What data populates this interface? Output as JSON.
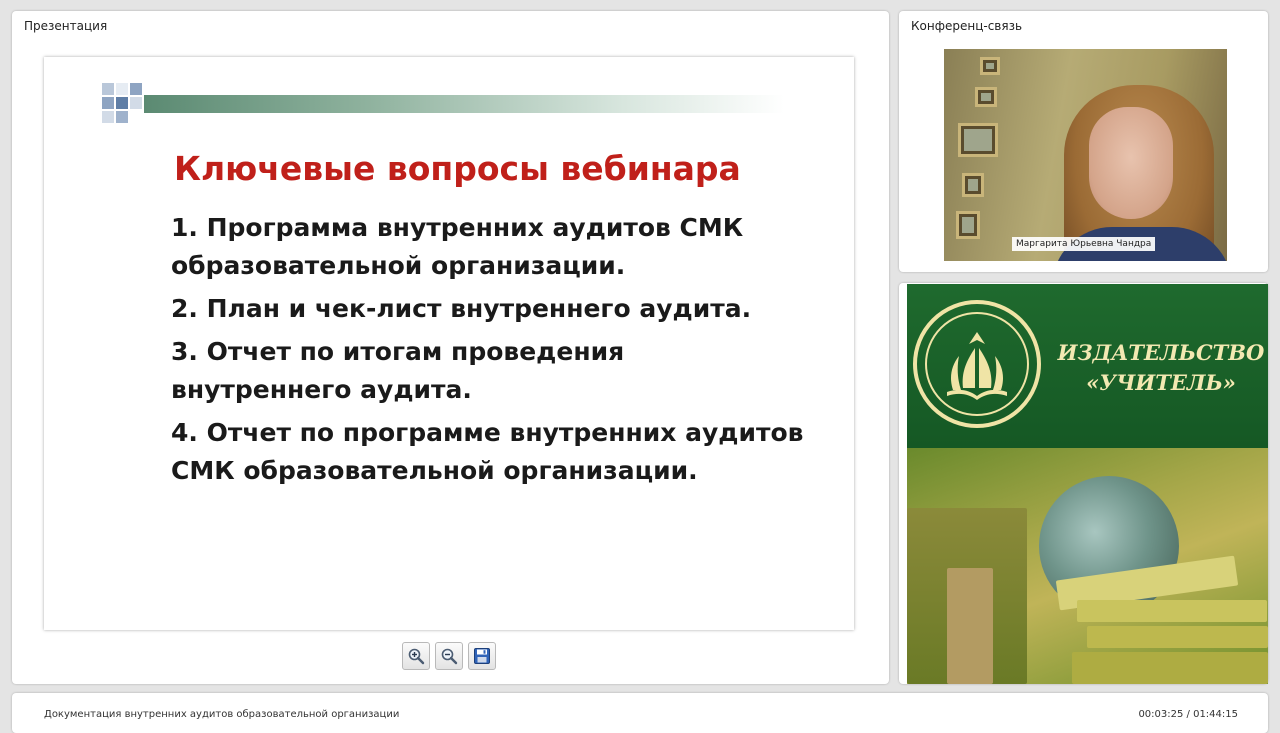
{
  "presentation": {
    "title": "Презентация",
    "slide": {
      "heading": "Ключевые вопросы вебинара",
      "items": [
        "1. Программа внутренних аудитов СМК образовательной организации.",
        "2. План и чек-лист внутреннего аудита.",
        "3. Отчет по итогам проведения внутреннего аудита.",
        "4. Отчет по программе внутренних аудитов СМК образовательной организации."
      ]
    },
    "toolbar": {
      "zoom_in_icon": "zoom-in-icon",
      "zoom_out_icon": "zoom-out-icon",
      "save_icon": "save-icon"
    }
  },
  "conference": {
    "title": "Конференц-связь",
    "speaker_name": "Маргарита Юрьевна Чандра"
  },
  "brand": {
    "line1": "ИЗДАТЕЛЬСТВО",
    "line2": "«УЧИТЕЛЬ»"
  },
  "footer": {
    "webinar_title": "Документация внутренних аудитов образовательной организации",
    "time": "00:03:25 / 01:44:15"
  },
  "colors": {
    "slide_heading": "#c0201a",
    "brand_green": "#1f6a2e",
    "brand_gold": "#f3e9b2"
  }
}
